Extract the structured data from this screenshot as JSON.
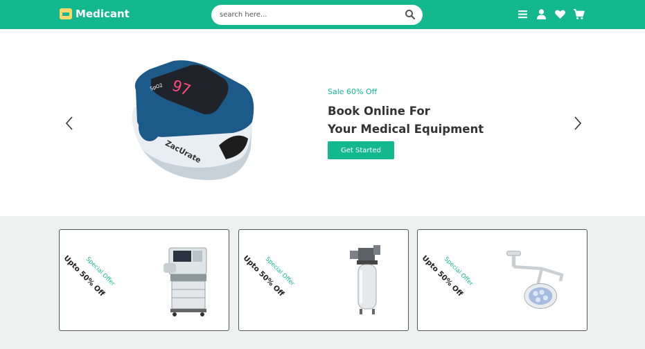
{
  "header": {
    "brand": "Medicant",
    "search_placeholder": "search here..."
  },
  "hero": {
    "sale_text": "Sale 60% Off",
    "headline_line1": "Book Online For",
    "headline_line2": "Your Medical Equipment",
    "cta_label": "Get Started",
    "product_text": "ZacUrate"
  },
  "offers": [
    {
      "label": "Special Offer",
      "discount": "Upto 50% Off",
      "image": "anesthesia-machine"
    },
    {
      "label": "Special Offer",
      "discount": "Upto 50% Off",
      "image": "air-compressor"
    },
    {
      "label": "Special Offer",
      "discount": "Upto 50% Off",
      "image": "surgical-light"
    }
  ],
  "colors": {
    "accent": "#13b88f",
    "offers_bg": "#eef1f0",
    "brand_icon": "#ffd66b"
  }
}
